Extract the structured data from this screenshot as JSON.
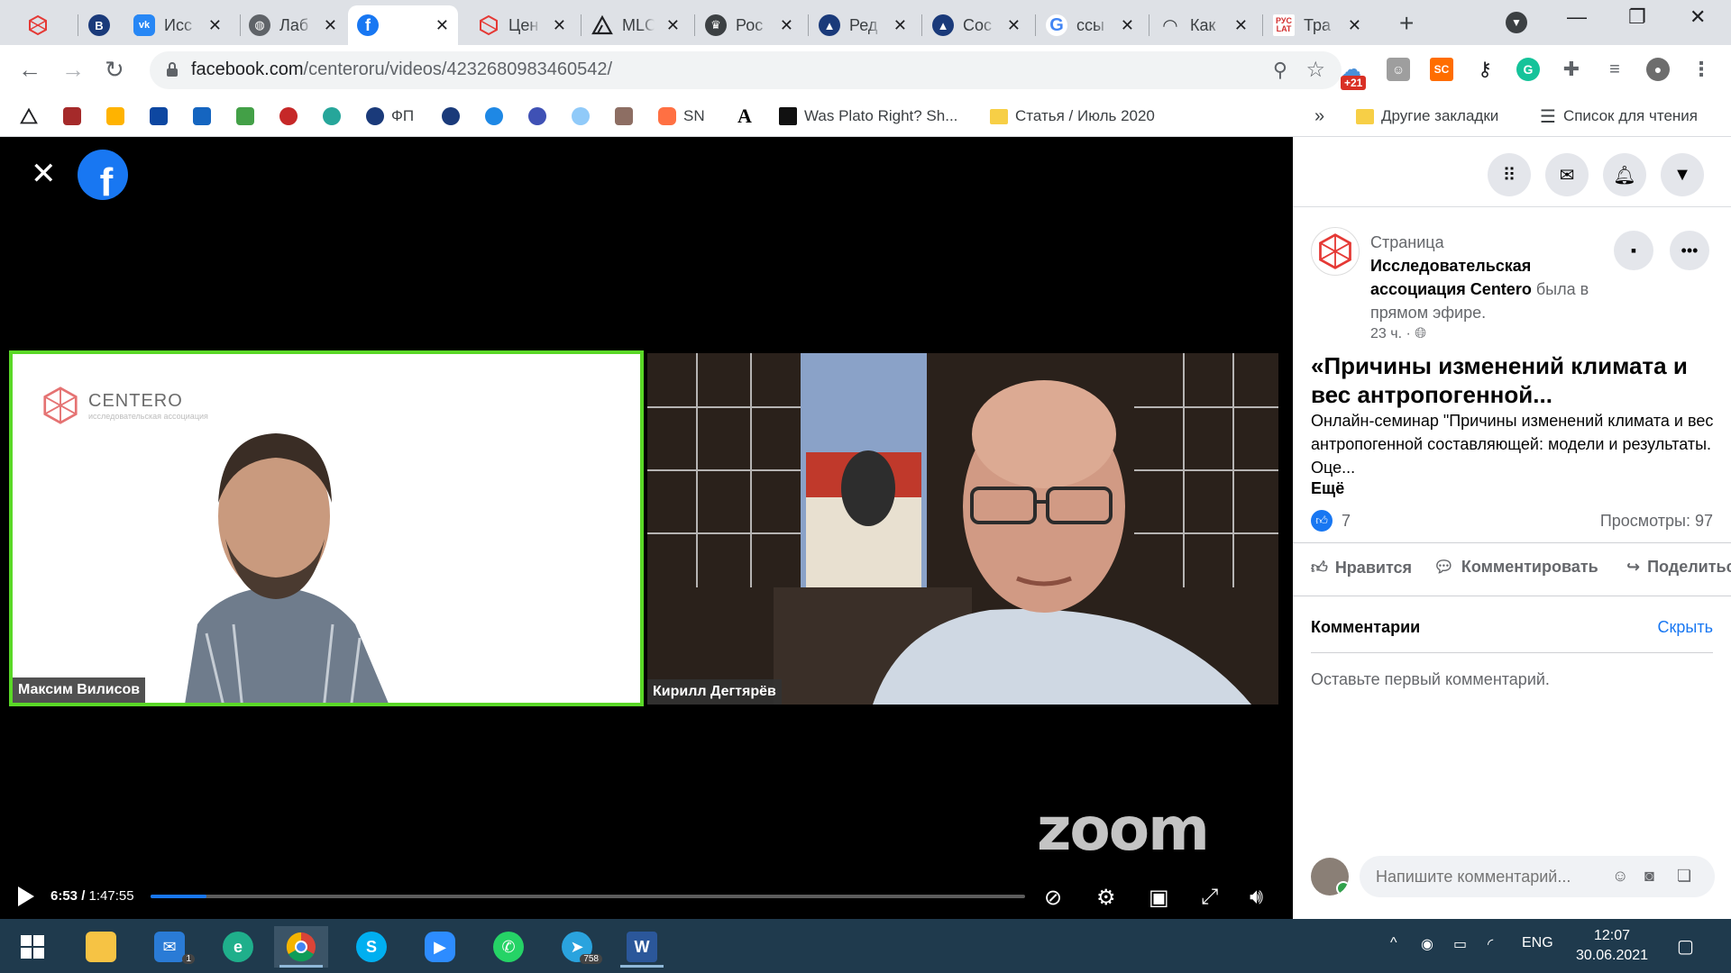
{
  "browser": {
    "tabs": [
      {
        "label": "",
        "icon": "centero-icon",
        "color": "#e53935"
      },
      {
        "label": "",
        "icon": "hse-icon",
        "color": "#1a3a7a"
      },
      {
        "label": "Исс",
        "icon": "vk-icon",
        "color": "#2787f5"
      },
      {
        "label": "Лаб",
        "icon": "globe-icon",
        "color": "#5f6368"
      },
      {
        "label": "",
        "icon": "facebook-icon",
        "color": "#1877f2"
      },
      {
        "label": "Цен",
        "icon": "centero-icon",
        "color": "#e53935"
      },
      {
        "label": "MLC",
        "icon": "triangle-icon",
        "color": "#202124"
      },
      {
        "label": "Рос",
        "icon": "eagle-icon",
        "color": "#3c4043"
      },
      {
        "label": "Ред",
        "icon": "dome-icon",
        "color": "#1a3a7a"
      },
      {
        "label": "Coc",
        "icon": "dome-icon",
        "color": "#1a3a7a"
      },
      {
        "label": "ссы",
        "icon": "google-icon",
        "color": "#4285f4"
      },
      {
        "label": "Как",
        "icon": "mask-icon",
        "color": "#3c4043"
      },
      {
        "label": "Тра",
        "icon": "ruslat-icon",
        "color": "#d32f2f"
      }
    ],
    "active_tab_index": 4,
    "url_host": "facebook.com",
    "url_path": "/centeroru/videos/4232680983460542/",
    "ext_badge": "+21",
    "bookmarks": {
      "fp": "ФП",
      "sn": "SN",
      "a": "A",
      "plato": "Was Plato Right? Sh...",
      "article": "Статья / Июль 2020",
      "more": "»",
      "other": "Другие закладки",
      "reading": "Список для чтения"
    }
  },
  "video": {
    "left_participant": "Максим Вилисов",
    "right_participant": "Кирилл Дегтярёв",
    "centero_logo": "CENTERO",
    "centero_sub": "исследовательская ассоциация",
    "zoom_watermark": "zoom",
    "time_current": "6:53",
    "time_total": "1:47:55",
    "progress_fraction": 0.0637
  },
  "post": {
    "page_label": "Страница",
    "page_name": "Исследовательская ассоциация Centero",
    "was_live": "была в прямом эфире.",
    "time_ago": "23 ч. ·",
    "title": "«Причины изменений климата и вес антропогенной...",
    "description": "Онлайн-семинар \"Причины изменений климата и вес антропогенной составляющей: модели и результаты. Оце...",
    "more": "Ещё",
    "likes": "7",
    "views": "Просмотры: 97",
    "like_btn": "Нравится",
    "comment_btn": "Комментировать",
    "share_btn": "Поделиться",
    "comments_header": "Комментарии",
    "hide": "Скрыть",
    "first_comment": "Оставьте первый комментарий.",
    "comment_placeholder": "Напишите комментарий..."
  },
  "taskbar": {
    "mail_badge": "1",
    "telegram_badge": "758",
    "lang": "ENG",
    "time": "12:07",
    "date": "30.06.2021"
  }
}
